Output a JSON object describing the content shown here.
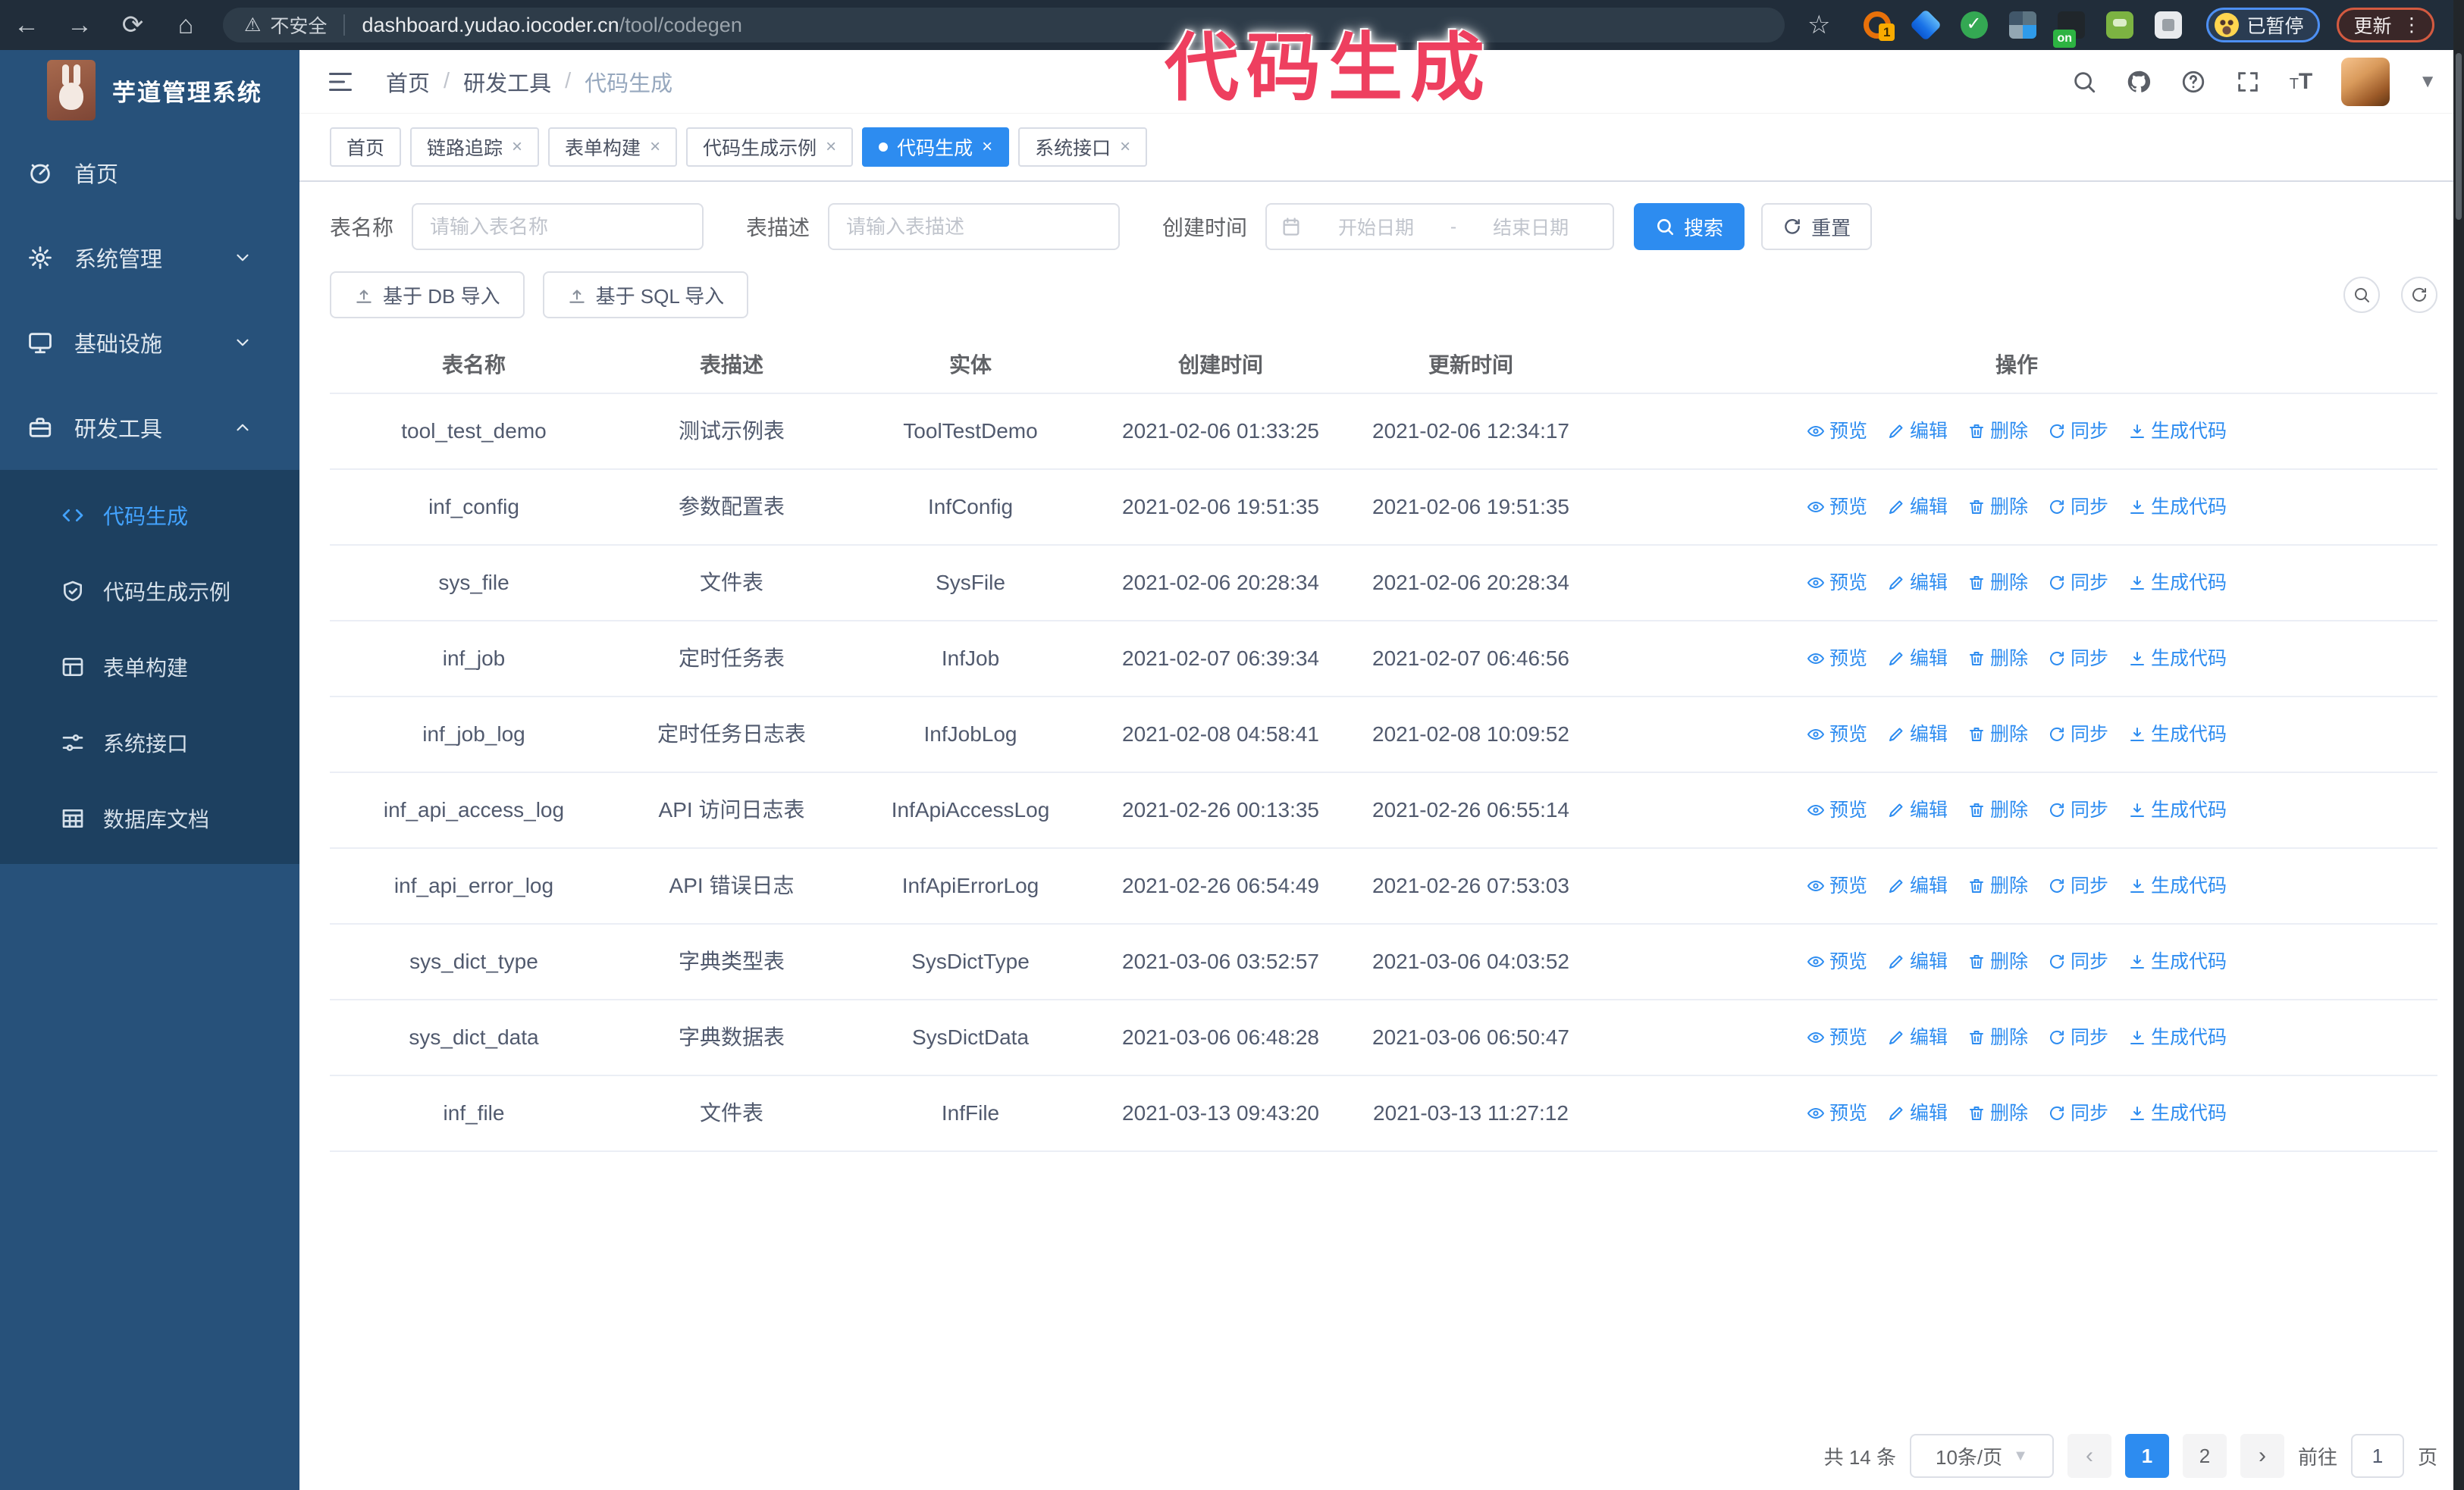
{
  "browser": {
    "security_label": "不安全",
    "url_domain": "dashboard.yudao.iocoder.cn",
    "url_path": "/tool/codegen",
    "ext1_badge": "1",
    "ext5_badge": "on",
    "paused_label": "已暂停",
    "update_label": "更新"
  },
  "overlay_title": "代码生成",
  "sidebar": {
    "logo_title": "芋道管理系统",
    "items": [
      {
        "key": "home",
        "label": "首页",
        "icon": "dashboard-icon"
      },
      {
        "key": "system-admin",
        "label": "系统管理",
        "icon": "gear-icon",
        "chevron": "down"
      },
      {
        "key": "infrastructure",
        "label": "基础设施",
        "icon": "monitor-icon",
        "chevron": "down"
      },
      {
        "key": "dev-tools",
        "label": "研发工具",
        "icon": "toolbox-icon",
        "chevron": "up",
        "expanded": true
      }
    ],
    "subitems": [
      {
        "key": "codegen",
        "label": "代码生成",
        "icon": "code-icon",
        "active": true
      },
      {
        "key": "codegen-example",
        "label": "代码生成示例",
        "icon": "shield-check-icon"
      },
      {
        "key": "form-builder",
        "label": "表单构建",
        "icon": "form-icon"
      },
      {
        "key": "system-api",
        "label": "系统接口",
        "icon": "sliders-icon"
      },
      {
        "key": "db-doc",
        "label": "数据库文档",
        "icon": "database-table-icon"
      }
    ]
  },
  "header": {
    "separator": "/",
    "breadcrumb": [
      {
        "label": "首页"
      },
      {
        "label": "研发工具"
      },
      {
        "label": "代码生成",
        "current": true
      }
    ]
  },
  "tabs": [
    {
      "key": "home",
      "label": "首页",
      "closable": false,
      "active": false
    },
    {
      "key": "tracing",
      "label": "链路追踪",
      "closable": true,
      "active": false
    },
    {
      "key": "form-builder",
      "label": "表单构建",
      "closable": true,
      "active": false
    },
    {
      "key": "codegen-example",
      "label": "代码生成示例",
      "closable": true,
      "active": false
    },
    {
      "key": "codegen",
      "label": "代码生成",
      "closable": true,
      "active": true
    },
    {
      "key": "system-api",
      "label": "系统接口",
      "closable": true,
      "active": false
    }
  ],
  "filters": {
    "table_name_label": "表名称",
    "table_name_placeholder": "请输入表名称",
    "table_desc_label": "表描述",
    "table_desc_placeholder": "请输入表描述",
    "create_time_label": "创建时间",
    "start_placeholder": "开始日期",
    "range_separator": "-",
    "end_placeholder": "结束日期",
    "search_label": "搜索",
    "reset_label": "重置"
  },
  "toolbar": {
    "import_db_label": "基于 DB 导入",
    "import_sql_label": "基于 SQL 导入"
  },
  "table": {
    "columns": [
      "表名称",
      "表描述",
      "实体",
      "创建时间",
      "更新时间",
      "操作"
    ],
    "actions": [
      {
        "key": "preview",
        "label": "预览",
        "icon": "eye-icon"
      },
      {
        "key": "edit",
        "label": "编辑",
        "icon": "edit-icon"
      },
      {
        "key": "delete",
        "label": "删除",
        "icon": "trash-icon"
      },
      {
        "key": "sync",
        "label": "同步",
        "icon": "sync-icon"
      },
      {
        "key": "generate",
        "label": "生成代码",
        "icon": "download-icon"
      }
    ],
    "rows": [
      {
        "name": "tool_test_demo",
        "desc": "测试示例表",
        "entity": "ToolTestDemo",
        "created": "2021-02-06 01:33:25",
        "updated": "2021-02-06 12:34:17"
      },
      {
        "name": "inf_config",
        "desc": "参数配置表",
        "entity": "InfConfig",
        "created": "2021-02-06 19:51:35",
        "updated": "2021-02-06 19:51:35"
      },
      {
        "name": "sys_file",
        "desc": "文件表",
        "entity": "SysFile",
        "created": "2021-02-06 20:28:34",
        "updated": "2021-02-06 20:28:34"
      },
      {
        "name": "inf_job",
        "desc": "定时任务表",
        "entity": "InfJob",
        "created": "2021-02-07 06:39:34",
        "updated": "2021-02-07 06:46:56"
      },
      {
        "name": "inf_job_log",
        "desc": "定时任务日志表",
        "entity": "InfJobLog",
        "created": "2021-02-08 04:58:41",
        "updated": "2021-02-08 10:09:52"
      },
      {
        "name": "inf_api_access_log",
        "desc": "API 访问日志表",
        "entity": "InfApiAccessLog",
        "created": "2021-02-26 00:13:35",
        "updated": "2021-02-26 06:55:14"
      },
      {
        "name": "inf_api_error_log",
        "desc": "API 错误日志",
        "entity": "InfApiErrorLog",
        "created": "2021-02-26 06:54:49",
        "updated": "2021-02-26 07:53:03"
      },
      {
        "name": "sys_dict_type",
        "desc": "字典类型表",
        "entity": "SysDictType",
        "created": "2021-03-06 03:52:57",
        "updated": "2021-03-06 04:03:52"
      },
      {
        "name": "sys_dict_data",
        "desc": "字典数据表",
        "entity": "SysDictData",
        "created": "2021-03-06 06:48:28",
        "updated": "2021-03-06 06:50:47"
      },
      {
        "name": "inf_file",
        "desc": "文件表",
        "entity": "InfFile",
        "created": "2021-03-13 09:43:20",
        "updated": "2021-03-13 11:27:12"
      }
    ]
  },
  "pagination": {
    "total_label": "共 14 条",
    "page_size_label": "10条/页",
    "pages": [
      "1",
      "2"
    ],
    "active_page": "1",
    "goto_label": "前往",
    "goto_value": "1",
    "unit_label": "页"
  },
  "colors": {
    "accent": "#2d8cf0",
    "overlay_pink": "#ee3f5f",
    "sidebar_bg": "#27517a",
    "submenu_bg": "#1d4060",
    "browser_bar_bg": "#212d3a",
    "link": "#2d8cf0"
  }
}
